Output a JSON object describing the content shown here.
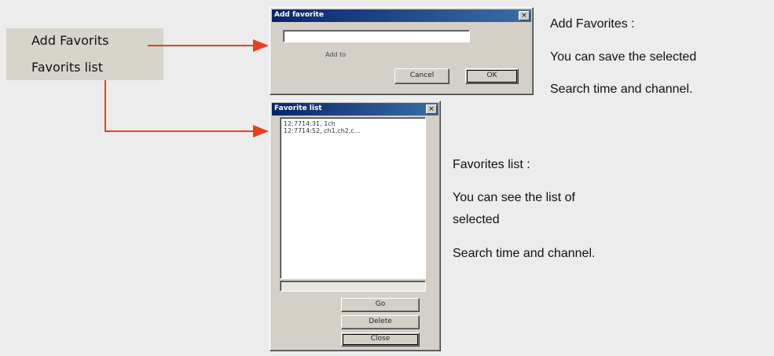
{
  "menu": {
    "items": [
      {
        "label": "Add Favorits"
      },
      {
        "label": "Favorits list"
      }
    ]
  },
  "add_dialog": {
    "title": "Add favorite",
    "close_glyph": "×",
    "input_value": "",
    "label": "Add to",
    "cancel_label": "Cancel",
    "ok_label": "OK"
  },
  "list_dialog": {
    "title": "Favorite list",
    "close_glyph": "×",
    "items": [
      {
        "text": "12:7714:31, 1ch"
      },
      {
        "text": "12:7714:52, ch1,ch2,c..."
      }
    ],
    "go_label": "Go",
    "delete_label": "Delete",
    "close_label": "Close"
  },
  "descriptions": {
    "add": {
      "heading": "Add Favorites :",
      "line1": "You can save the selected",
      "line2": "Search time and channel."
    },
    "list": {
      "heading": "Favorites list :",
      "line1": "You can see the list of",
      "line2": "selected",
      "line3": "Search time and channel."
    }
  },
  "colors": {
    "connector": "#e8401c",
    "titlebar": "#0a246a"
  }
}
